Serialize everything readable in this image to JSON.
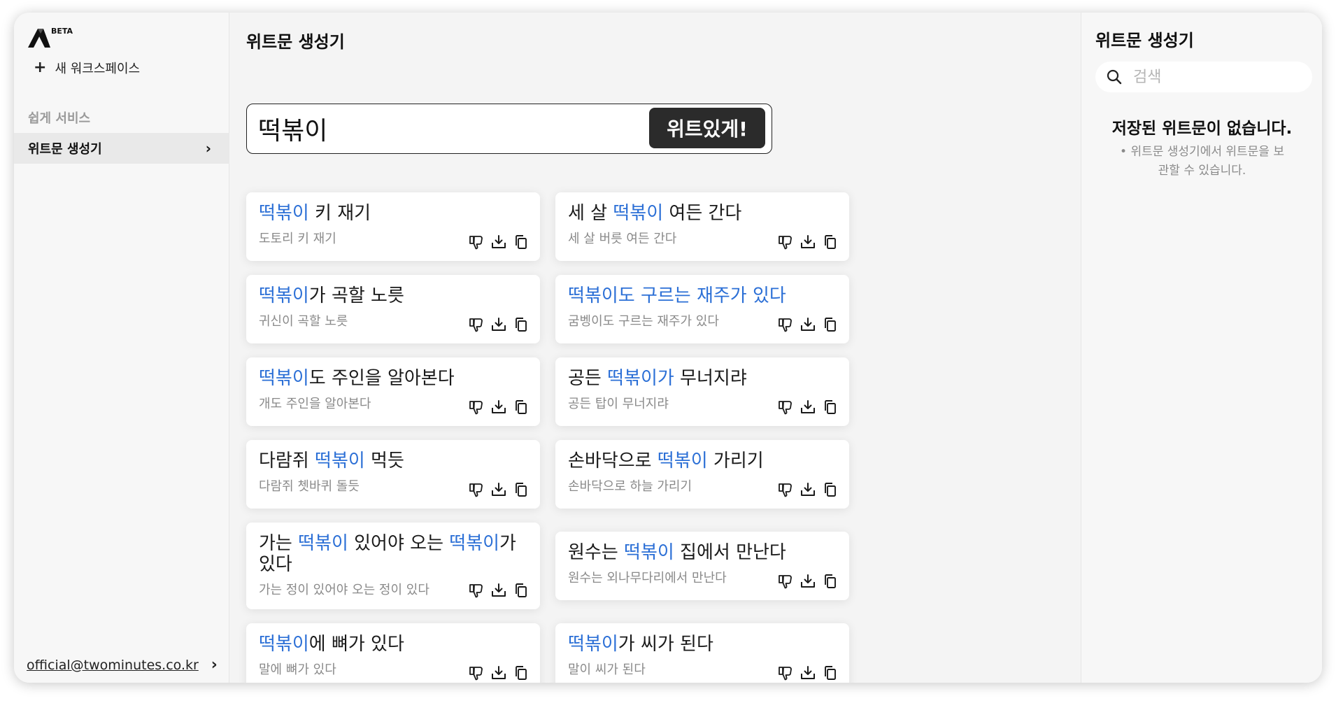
{
  "sidebar": {
    "logo": "logo-icon",
    "beta_label": "BETA",
    "new_workspace": "새 워크스페이스",
    "section_label": "쉽게 서비스",
    "nav_item_label": "위트문 생성기",
    "contact_email": "official@twominutes.co.kr"
  },
  "main": {
    "title": "위트문 생성기",
    "search_value": "떡볶이",
    "generate_button": "위트있게!",
    "highlight_color": "#2b6fd6",
    "card_actions": [
      "thumbs-down-icon",
      "download-icon",
      "copy-icon"
    ],
    "cards": [
      {
        "pre": "",
        "kw": "떡볶이",
        "post": " 키 재기",
        "pre2": "",
        "kw2": "",
        "post2": "",
        "original": "도토리 키 재기"
      },
      {
        "pre": "세 살 ",
        "kw": "떡볶이",
        "post": " 여든 간다",
        "pre2": "",
        "kw2": "",
        "post2": "",
        "original": "세 살 버릇 여든 간다"
      },
      {
        "pre": "",
        "kw": "떡볶이",
        "post": "가 곡할 노릇",
        "pre2": "",
        "kw2": "",
        "post2": "",
        "original": "귀신이 곡할 노릇"
      },
      {
        "pre": "",
        "kw": "떡볶이도 구르는 재주가 있다",
        "post": "",
        "pre2": "",
        "kw2": "",
        "post2": "",
        "original": "굼벵이도 구르는 재주가 있다"
      },
      {
        "pre": "",
        "kw": "떡볶이",
        "post": "도 주인을 알아본다",
        "pre2": "",
        "kw2": "",
        "post2": "",
        "original": "개도 주인을 알아본다"
      },
      {
        "pre": "공든 ",
        "kw": "떡볶이가",
        "post": " 무너지랴",
        "pre2": "",
        "kw2": "",
        "post2": "",
        "original": "공든 탑이 무너지랴"
      },
      {
        "pre": "다람쥐 ",
        "kw": "떡볶이",
        "post": " 먹듯",
        "pre2": "",
        "kw2": "",
        "post2": "",
        "original": "다람쥐 쳇바퀴 돌듯"
      },
      {
        "pre": "손바닥으로 ",
        "kw": "떡볶이",
        "post": " 가리기",
        "pre2": "",
        "kw2": "",
        "post2": "",
        "original": "손바닥으로 하늘 가리기"
      },
      {
        "pre": "가는 ",
        "kw": "떡볶이",
        "post": " 있어야 오는 ",
        "pre2": "",
        "kw2": "떡볶이",
        "post2": "가 있다",
        "original": "가는 정이 있어야 오는 정이 있다"
      },
      {
        "pre": "원수는 ",
        "kw": "떡볶이",
        "post": " 집에서 만난다",
        "pre2": "",
        "kw2": "",
        "post2": "",
        "original": "원수는 외나무다리에서 만난다"
      },
      {
        "pre": "",
        "kw": "떡볶이",
        "post": "에 뼈가 있다",
        "pre2": "",
        "kw2": "",
        "post2": "",
        "original": "말에 뼈가 있다"
      },
      {
        "pre": "",
        "kw": "떡볶이",
        "post": "가 씨가 된다",
        "pre2": "",
        "kw2": "",
        "post2": "",
        "original": "말이 씨가 된다"
      }
    ]
  },
  "right_panel": {
    "title": "위트문 생성기",
    "search_placeholder": "검색",
    "empty_title": "저장된 위트문이 없습니다.",
    "empty_desc": "• 위트문 생성기에서 위트문을 보관할 수 있습니다."
  }
}
